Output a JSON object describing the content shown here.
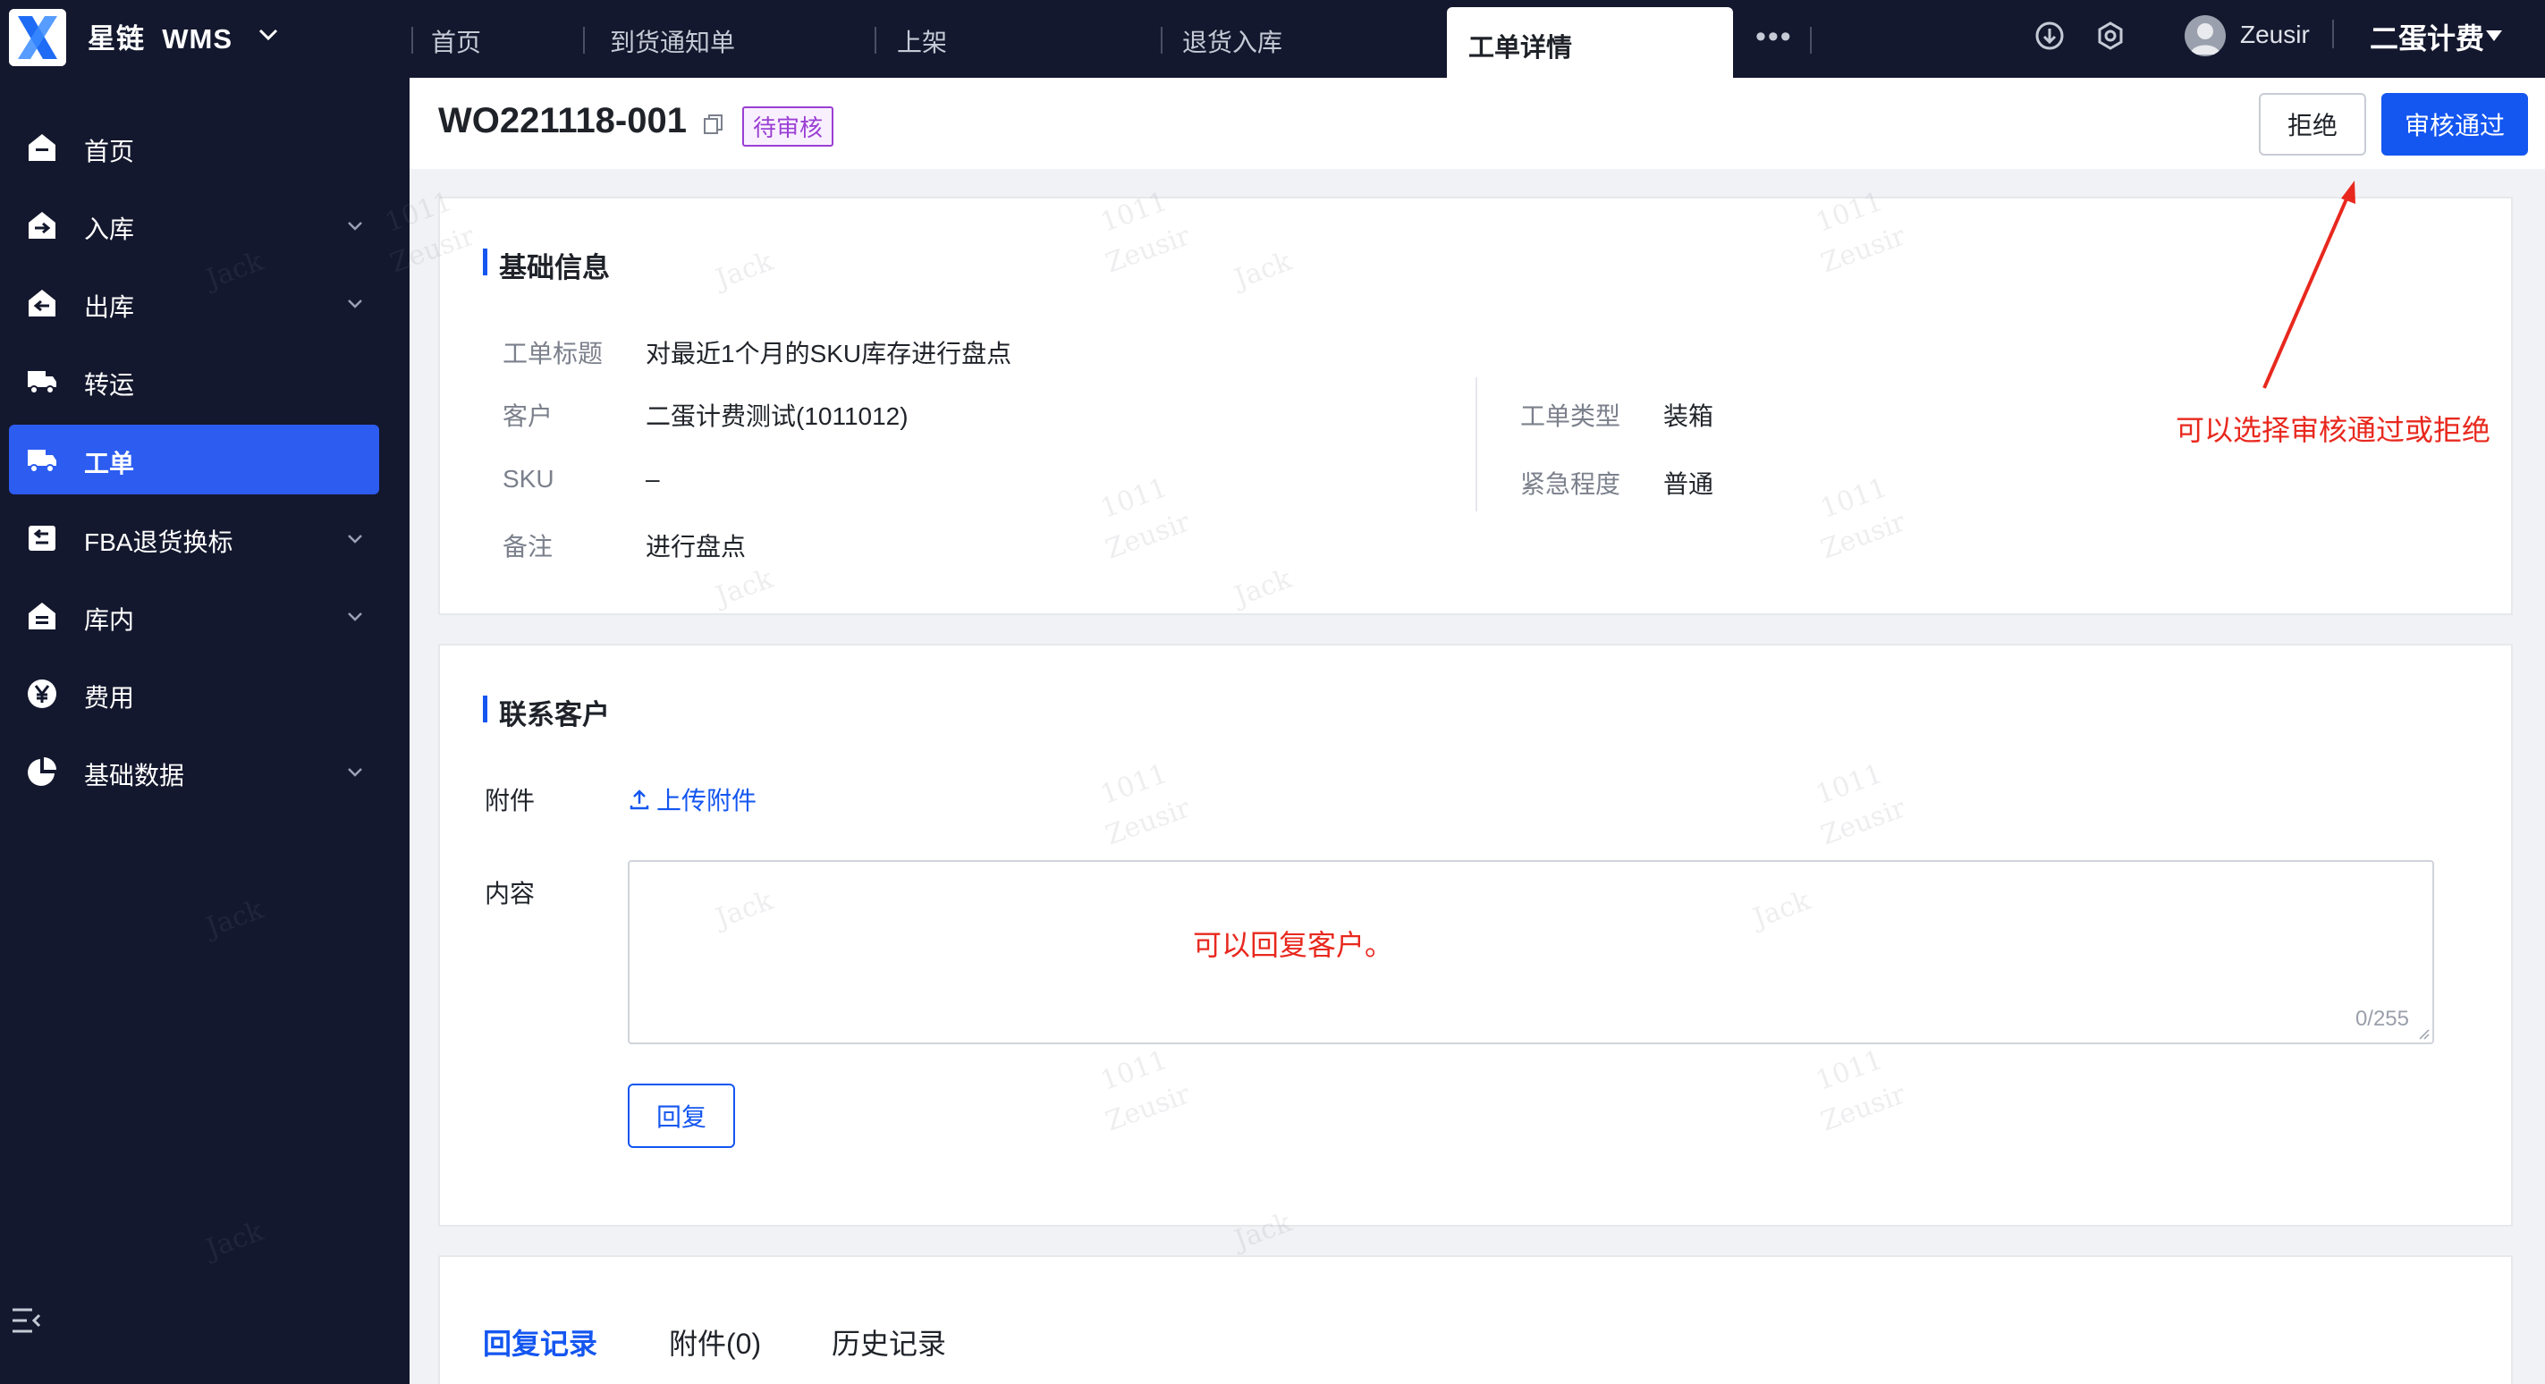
{
  "app": {
    "brand": "星链",
    "product": "WMS"
  },
  "tabs": [
    {
      "label": "首页"
    },
    {
      "label": "到货通知单"
    },
    {
      "label": "上架"
    },
    {
      "label": "退货入库"
    },
    {
      "label": "工单详情",
      "active": true
    }
  ],
  "topbar": {
    "more": "•••",
    "user_name": "Zeusir",
    "company": "二蛋计费"
  },
  "sidebar": {
    "items": [
      {
        "label": "首页",
        "icon": "home-icon",
        "expandable": false
      },
      {
        "label": "入库",
        "icon": "inbound-icon",
        "expandable": true
      },
      {
        "label": "出库",
        "icon": "outbound-icon",
        "expandable": true
      },
      {
        "label": "转运",
        "icon": "truck-icon",
        "expandable": false
      },
      {
        "label": "工单",
        "icon": "work-order-icon",
        "expandable": false,
        "active": true
      },
      {
        "label": "FBA退货换标",
        "icon": "return-icon",
        "expandable": true
      },
      {
        "label": "库内",
        "icon": "warehouse-icon",
        "expandable": true
      },
      {
        "label": "费用",
        "icon": "yen-icon",
        "expandable": false
      },
      {
        "label": "基础数据",
        "icon": "pie-chart-icon",
        "expandable": true
      }
    ]
  },
  "header": {
    "work_order_no": "WO221118-001",
    "status": "待审核",
    "reject_label": "拒绝",
    "approve_label": "审核通过"
  },
  "basic_info": {
    "title": "基础信息",
    "fields": {
      "subject_label": "工单标题",
      "subject_value": "对最近1个月的SKU库存进行盘点",
      "customer_label": "客户",
      "customer_value": "二蛋计费测试(1011012)",
      "sku_label": "SKU",
      "sku_value": "–",
      "remark_label": "备注",
      "remark_value": "进行盘点",
      "type_label": "工单类型",
      "type_value": "装箱",
      "urgency_label": "紧急程度",
      "urgency_value": "普通"
    }
  },
  "contact": {
    "title": "联系客户",
    "attachment_label": "附件",
    "upload_label": "上传附件",
    "content_label": "内容",
    "counter": "0/255",
    "reply_label": "回复"
  },
  "records": {
    "tabs": [
      "回复记录",
      "附件(0)",
      "历史记录"
    ]
  },
  "annotations": {
    "approve_hint": "可以选择审核通过或拒绝",
    "reply_hint": "可以回复客户。"
  },
  "watermark": {
    "lines": [
      "1011",
      "Zeusir",
      "Jack"
    ]
  },
  "colors": {
    "primary": "#1456f0",
    "nav_bg": "#14182e",
    "status_purple": "#9b3fd4",
    "annotation_red": "#e8281e"
  }
}
